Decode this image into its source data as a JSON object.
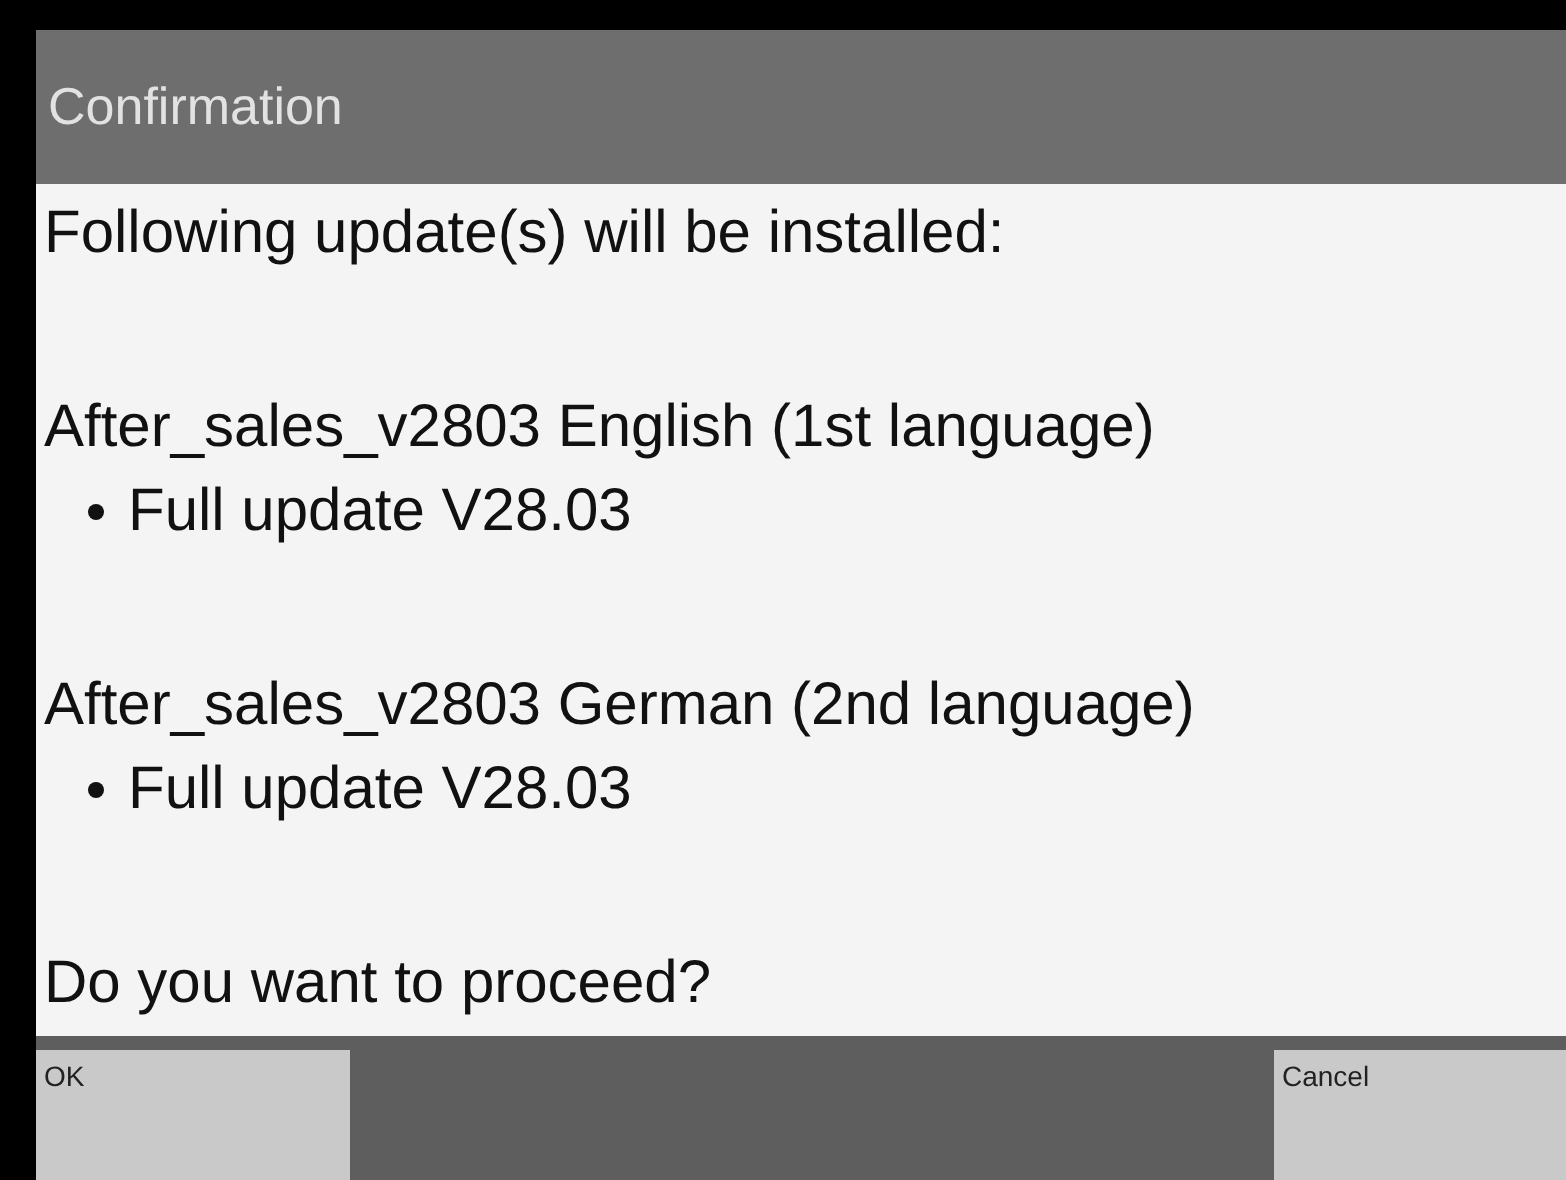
{
  "window": {
    "title": "Confirmation"
  },
  "message": {
    "intro": "Following update(s) will be installed:",
    "updates": [
      {
        "name": "After_sales_v2803 English (1st language)",
        "items": [
          "Full update V28.03"
        ]
      },
      {
        "name": "After_sales_v2803 German (2nd language)",
        "items": [
          "Full update V28.03"
        ]
      }
    ],
    "question": "Do you want to proceed?"
  },
  "buttons": [
    {
      "label": "OK",
      "kind": "left"
    },
    {
      "label": "Cancel",
      "kind": "right"
    }
  ]
}
